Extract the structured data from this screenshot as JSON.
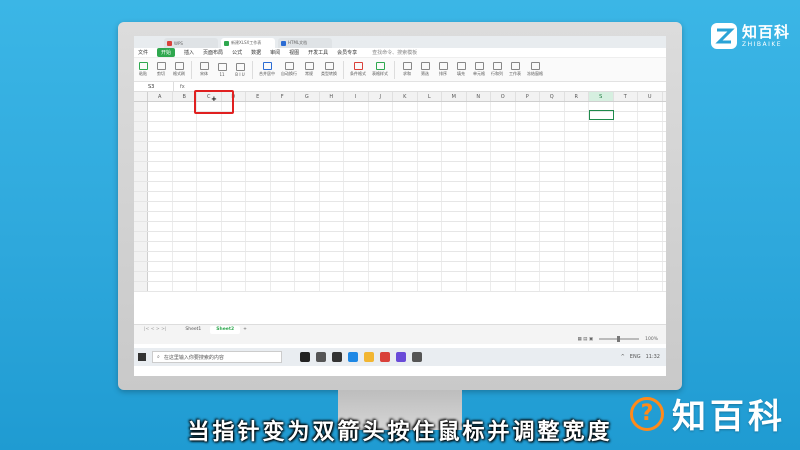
{
  "brand": {
    "top_cn": "知百科",
    "top_en": "ZHIBAIKE",
    "bottom_icon": "?",
    "bottom_text": "知百科"
  },
  "titlebar": {
    "tabs": [
      {
        "label": "WPS",
        "color": "#d9413a"
      },
      {
        "label": "新建XLSX工作表",
        "color": "#2fa84f"
      },
      {
        "label": "HTML文档",
        "color": "#2b6cd4"
      }
    ]
  },
  "menu": {
    "file": "文件",
    "start": "开始",
    "items": [
      "插入",
      "页面布局",
      "公式",
      "数据",
      "审阅",
      "视图",
      "开发工具",
      "会员专享"
    ],
    "search": "查找命令、搜索模板"
  },
  "ribbon": {
    "groups": [
      {
        "label": "粘贴",
        "icon": "paste-icon",
        "tone": "g"
      },
      {
        "label": "剪切",
        "icon": "cut-icon",
        "tone": ""
      },
      {
        "label": "格式刷",
        "icon": "format-painter-icon",
        "tone": ""
      },
      {
        "label": "宋体",
        "icon": "font-icon",
        "tone": ""
      },
      {
        "label": "11",
        "icon": "font-size-icon",
        "tone": ""
      },
      {
        "label": "B I U",
        "icon": "bold-icon",
        "tone": ""
      },
      {
        "label": "合并居中",
        "icon": "merge-icon",
        "tone": "b"
      },
      {
        "label": "自动换行",
        "icon": "wrap-icon",
        "tone": ""
      },
      {
        "label": "常规",
        "icon": "number-format-icon",
        "tone": ""
      },
      {
        "label": "类型转换",
        "icon": "convert-icon",
        "tone": ""
      },
      {
        "label": "条件格式",
        "icon": "conditional-format-icon",
        "tone": "r"
      },
      {
        "label": "表格样式",
        "icon": "table-style-icon",
        "tone": "g"
      },
      {
        "label": "求和",
        "icon": "sum-icon",
        "tone": ""
      },
      {
        "label": "筛选",
        "icon": "filter-icon",
        "tone": ""
      },
      {
        "label": "排序",
        "icon": "sort-icon",
        "tone": ""
      },
      {
        "label": "填充",
        "icon": "fill-icon",
        "tone": ""
      },
      {
        "label": "单元格",
        "icon": "cell-icon",
        "tone": ""
      },
      {
        "label": "行和列",
        "icon": "row-col-icon",
        "tone": ""
      },
      {
        "label": "工作表",
        "icon": "sheet-icon",
        "tone": ""
      },
      {
        "label": "冻结窗格",
        "icon": "freeze-icon",
        "tone": ""
      }
    ]
  },
  "formula": {
    "namebox": "S3",
    "fx": "fx"
  },
  "grid": {
    "columns": [
      "A",
      "B",
      "C",
      "D",
      "E",
      "F",
      "G",
      "H",
      "I",
      "J",
      "K",
      "L",
      "M",
      "N",
      "O",
      "P",
      "Q",
      "R",
      "S",
      "T",
      "U"
    ],
    "selected_column": "S",
    "row_count": 19,
    "cursor_symbol": "+"
  },
  "sheets": {
    "nav": "|< < > >|",
    "tabs": [
      "Sheet1",
      "Sheet2"
    ],
    "active": "Sheet2",
    "add": "+"
  },
  "status": {
    "zoom": "100%"
  },
  "taskbar": {
    "search_placeholder": "在这里输入你要搜索的内容",
    "apps": [
      {
        "name": "cortana-icon",
        "color": "#222222"
      },
      {
        "name": "task-view-icon",
        "color": "#555555"
      },
      {
        "name": "terminal-icon",
        "color": "#333333"
      },
      {
        "name": "edge-icon",
        "color": "#1e88e5"
      },
      {
        "name": "explorer-icon",
        "color": "#f2b632"
      },
      {
        "name": "wps-icon",
        "color": "#d9413a"
      },
      {
        "name": "app-icon",
        "color": "#6a4bd8"
      },
      {
        "name": "settings-icon",
        "color": "#555555"
      }
    ],
    "tray": [
      "^",
      "ENG",
      "11:32"
    ]
  },
  "caption": "当指针变为双箭头按住鼠标并调整宽度"
}
